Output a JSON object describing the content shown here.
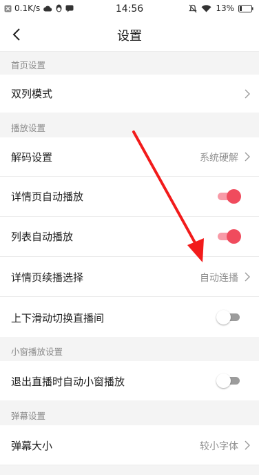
{
  "status_bar": {
    "speed": "0.1K/s",
    "time": "14:56",
    "battery": "13%"
  },
  "header": {
    "title": "设置"
  },
  "sections": [
    {
      "title": "首页设置"
    },
    {
      "title": "播放设置"
    },
    {
      "title": "小窗播放设置"
    },
    {
      "title": "弹幕设置"
    }
  ],
  "rows": {
    "dual_column": {
      "label": "双列模式"
    },
    "decode": {
      "label": "解码设置",
      "value": "系统硬解"
    },
    "detail_autoplay": {
      "label": "详情页自动播放",
      "enabled": true
    },
    "list_autoplay": {
      "label": "列表自动播放",
      "enabled": true
    },
    "detail_continue": {
      "label": "详情页续播选择",
      "value": "自动连播"
    },
    "swipe_switch": {
      "label": "上下滑动切换直播间",
      "enabled": false
    },
    "exit_mini": {
      "label": "退出直播时自动小窗播放",
      "enabled": false
    },
    "danmaku_size": {
      "label": "弹幕大小",
      "value": "较小字体"
    }
  },
  "colors": {
    "accent": "#f04b5d",
    "annotation_arrow": "#f21b1b"
  }
}
